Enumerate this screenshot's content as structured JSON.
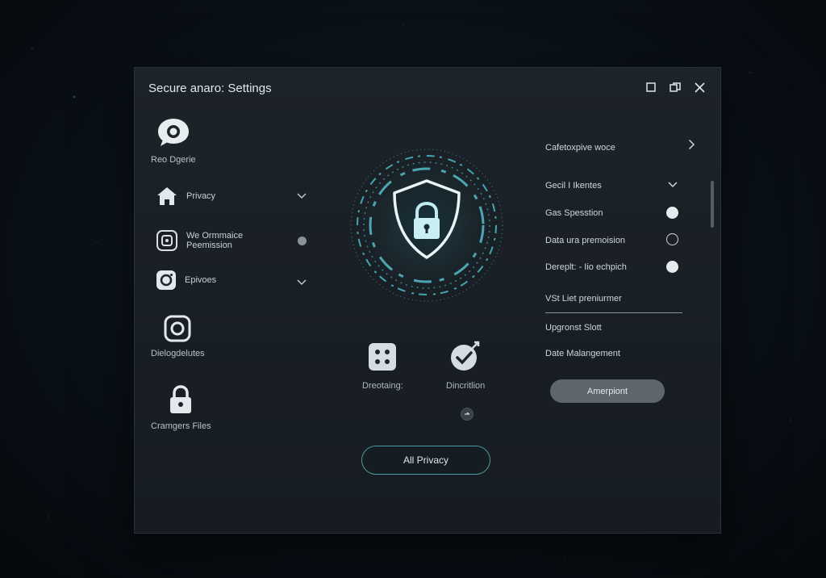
{
  "window": {
    "title": "Secure anaro: Settings"
  },
  "sidebar": {
    "items": [
      {
        "label": "Reo Dgerie",
        "icon": "chat-bubble-icon"
      },
      {
        "label": "Privacy",
        "icon": "home-icon",
        "expandable": true
      },
      {
        "label_line1": "We Ormmaice",
        "label_line2": "Peemission",
        "icon": "camera-icon"
      },
      {
        "label": "Epivoes",
        "icon": "instagram-icon",
        "expandable": true
      },
      {
        "label": "Dielogdelutes",
        "icon": "camera-square-icon"
      },
      {
        "label": "Cramgers Files",
        "icon": "lock-icon"
      }
    ]
  },
  "center": {
    "tiles": [
      {
        "label": "Dreotaing:",
        "icon": "dice-icon"
      },
      {
        "label": "Dincritlion",
        "icon": "check-badge-icon"
      }
    ],
    "privacy_button": "All Privacy"
  },
  "right_panel": {
    "header": "Cafetoxpive woce",
    "section": "Gecil I Ikentes",
    "toggles": [
      {
        "label": "Gas Spesstion",
        "state": "on"
      },
      {
        "label": "Data ura premoision",
        "state": "off"
      },
      {
        "label": "Dereplt: - Iio echpich",
        "state": "on"
      }
    ],
    "links": [
      "VSt Liet preniurmer",
      "Upgronst Slott",
      "Date Malangement"
    ],
    "apply_button": "Amerpiont"
  },
  "colors": {
    "accent": "#4fc7d6",
    "window_bg": "#1a2026",
    "button_gray": "#5e666c"
  }
}
